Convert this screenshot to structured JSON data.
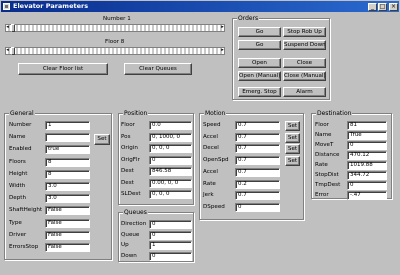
{
  "window": {
    "title": "Elevator Parameters",
    "buttons": [
      "_",
      "□",
      "×"
    ]
  },
  "sliders": [
    {
      "label": "Number 1",
      "position": 0.0
    },
    {
      "label": "Floor 8",
      "position": 0.0
    }
  ],
  "top_buttons": [
    "Clear Floor list",
    "Clear Queues"
  ],
  "cmd": {
    "title": "Orders",
    "buttons": [
      "Go",
      "Stop Rob Up",
      "Go",
      "Suspend Down",
      "Open",
      "Close",
      "Open (Manual)",
      "Close (Manual)",
      "Emerg. Stop",
      "Alarm"
    ]
  },
  "general": {
    "title": "General",
    "rows": [
      {
        "label": "Number",
        "value": "1"
      },
      {
        "label": "Name",
        "value": ""
      },
      {
        "label": "Enabled",
        "value": "true"
      },
      {
        "label": "Floors",
        "value": "8"
      },
      {
        "label": "Height",
        "value": "8"
      },
      {
        "label": "Width",
        "value": "3.0"
      },
      {
        "label": "Depth",
        "value": "3.0"
      },
      {
        "label": "ShaftHeight",
        "value": "False"
      },
      {
        "label": "Type",
        "value": "False"
      },
      {
        "label": "Driver",
        "value": "False"
      },
      {
        "label": "ErrorsStop",
        "value": "False"
      }
    ],
    "set_label": "Set"
  },
  "position": {
    "title": "Position",
    "rows": [
      {
        "label": "Floor",
        "value": "0.0"
      },
      {
        "label": "Pos",
        "value": "0, 1000, 0"
      },
      {
        "label": "Origin",
        "value": "0, 0, 0"
      },
      {
        "label": "OrigFlr",
        "value": "0"
      },
      {
        "label": "Dest",
        "value": "846.58"
      },
      {
        "label": "Dest",
        "value": "0.00, 0, 0"
      },
      {
        "label": "SLDest",
        "value": "0, 0, 0"
      }
    ]
  },
  "queues": {
    "title": "Queues",
    "rows": [
      {
        "label": "Direction",
        "value": "0"
      },
      {
        "label": "Queue",
        "value": "0"
      },
      {
        "label": "Up",
        "value": "1"
      },
      {
        "label": "Down",
        "value": "0"
      }
    ]
  },
  "motion": {
    "title": "Motion",
    "rows": [
      {
        "label": "Speed",
        "value": "0.7"
      },
      {
        "label": "Accel",
        "value": "0.7"
      },
      {
        "label": "Decel",
        "value": "0.7"
      },
      {
        "label": "OpenSpd",
        "value": "0.7"
      },
      {
        "label": "Accel",
        "value": "0.7"
      },
      {
        "label": "Rate",
        "value": "0.2"
      },
      {
        "label": "Jerk",
        "value": "0.7"
      },
      {
        "label": "DSpeed",
        "value": "0"
      }
    ],
    "set_label": "Set"
  },
  "destination": {
    "title": "Destination",
    "rows": [
      {
        "label": "Floor",
        "value": "81"
      },
      {
        "label": "Name",
        "value": "True"
      },
      {
        "label": "MoveT",
        "value": "0"
      },
      {
        "label": "Distance",
        "value": "470.12"
      },
      {
        "label": "Rate",
        "value": "1019.88"
      },
      {
        "label": "StopDist",
        "value": "344.72"
      },
      {
        "label": "TmpDest",
        "value": "0"
      },
      {
        "label": "Error",
        "value": "-.47"
      }
    ]
  }
}
